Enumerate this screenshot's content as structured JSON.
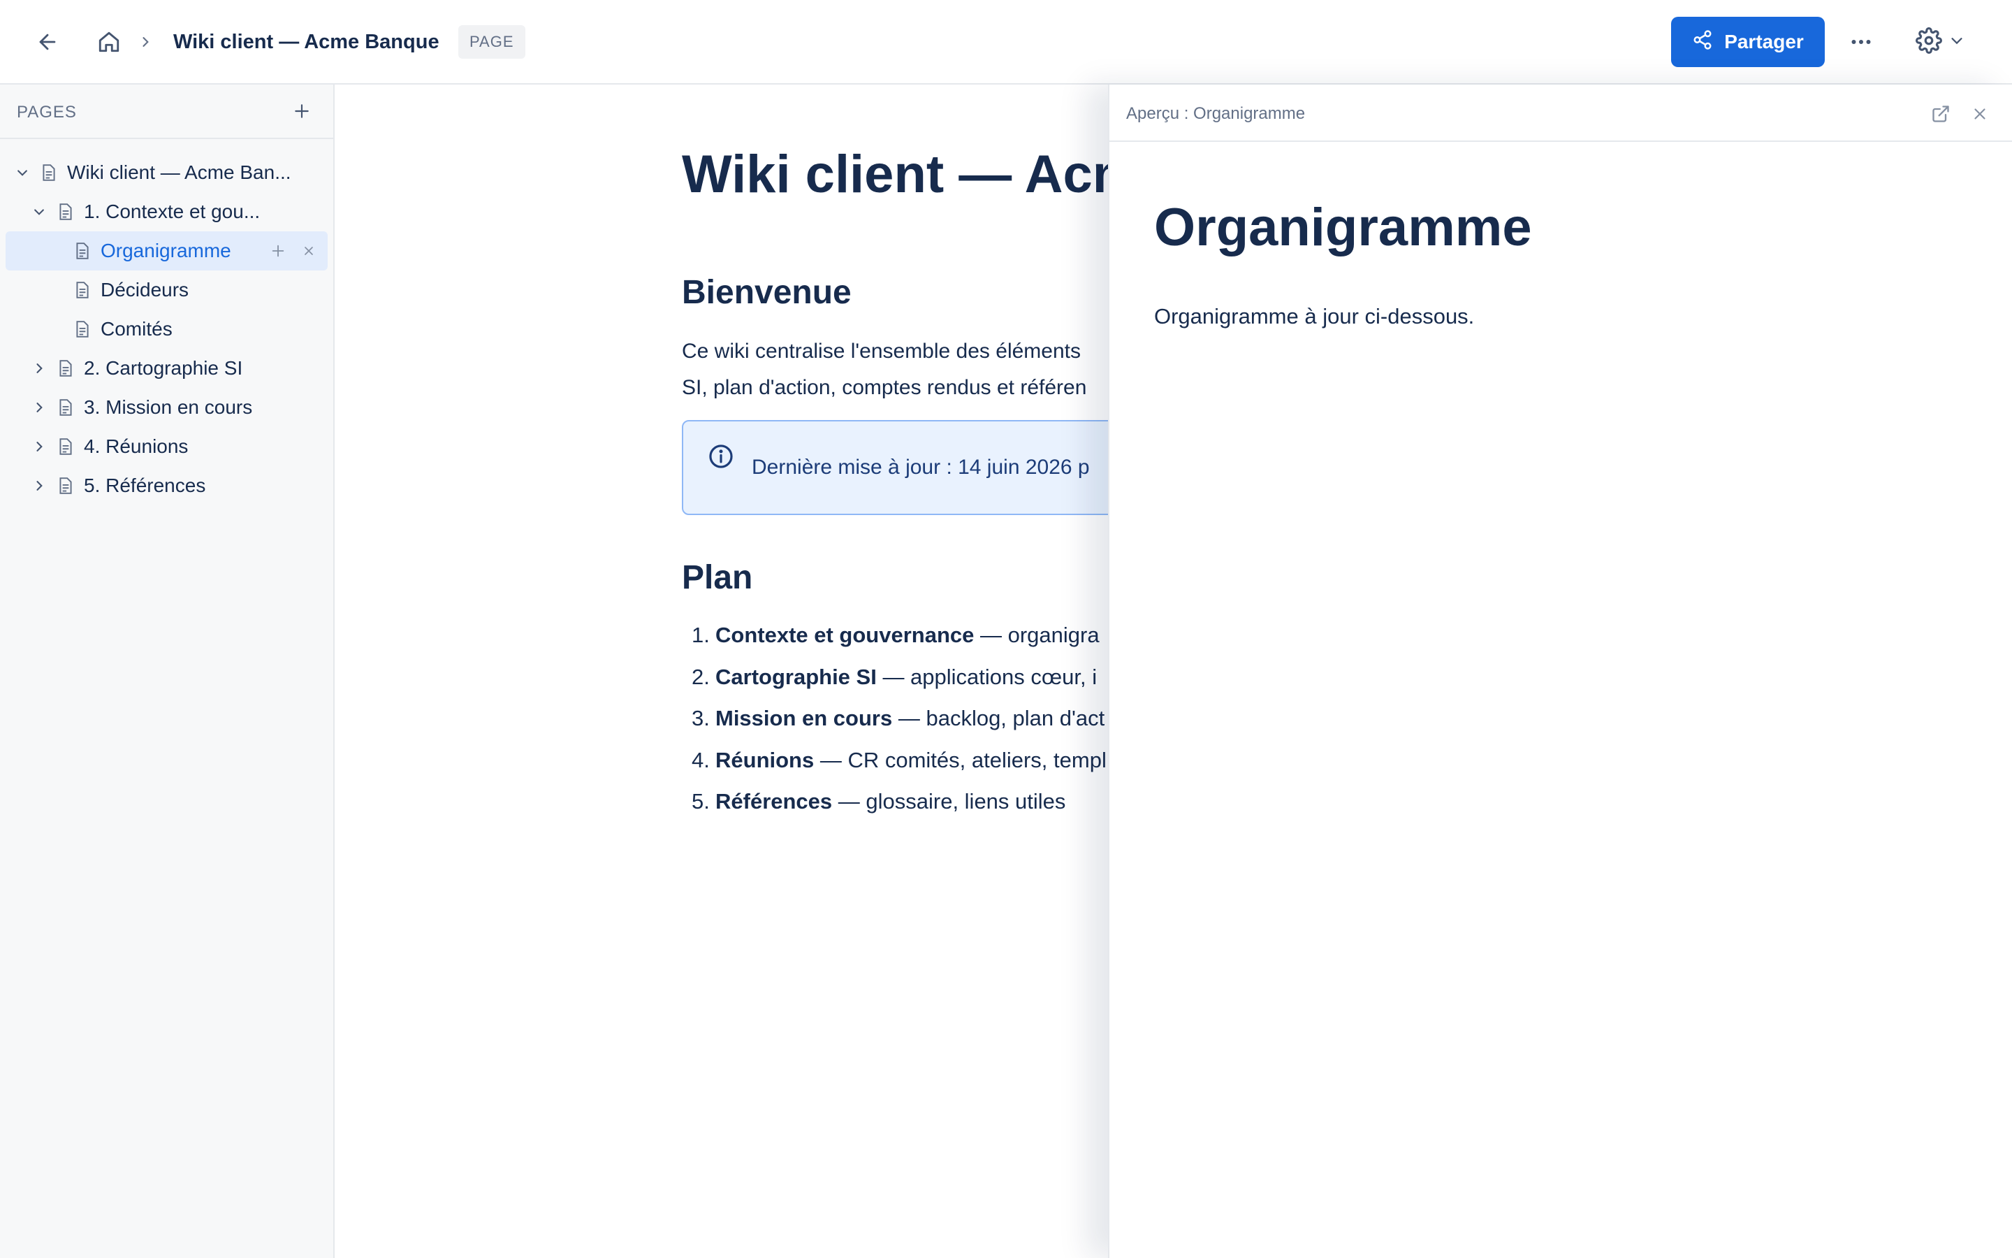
{
  "topbar": {
    "title": "Wiki client — Acme Banque",
    "badge": "PAGE",
    "share_label": "Partager",
    "icons": {
      "back": "arrow-left-icon",
      "home": "home-icon",
      "separator": "chevron-right-icon",
      "share": "share-icon",
      "more": "more-horizontal-icon",
      "settings": "gear-icon",
      "settings_caret": "chevron-down-icon"
    }
  },
  "sidebar": {
    "title": "PAGES",
    "items": [
      {
        "label": "Wiki client — Acme Ban...",
        "level": 0,
        "expanded": true
      },
      {
        "label": "1. Contexte et gou...",
        "level": 1,
        "expanded": true
      },
      {
        "label": "Organigramme",
        "level": 2,
        "selected": true
      },
      {
        "label": "Décideurs",
        "level": 2
      },
      {
        "label": "Comités",
        "level": 2
      },
      {
        "label": "2. Cartographie SI",
        "level": 1,
        "expanded": false
      },
      {
        "label": "3. Mission en cours",
        "level": 1,
        "expanded": false
      },
      {
        "label": "4. Réunions",
        "level": 1,
        "expanded": false
      },
      {
        "label": "5. Références",
        "level": 1,
        "expanded": false
      }
    ]
  },
  "page": {
    "title": "Wiki client — Acme Banque",
    "welcome_heading": "Bienvenue",
    "intro_line1": "Ce wiki centralise l'ensemble des éléments ",
    "intro_line2": "SI, plan d'action, comptes rendus et référen",
    "info_text": "Dernière mise à jour : 14 juin 2026 p",
    "plan_heading": "Plan",
    "plan": [
      {
        "num": "1.",
        "bold": "Contexte et gouvernance",
        "rest": " — organigra"
      },
      {
        "num": "2.",
        "bold": "Cartographie SI",
        "rest": " — applications cœur, i"
      },
      {
        "num": "3.",
        "bold": "Mission en cours",
        "rest": " — backlog, plan d'act"
      },
      {
        "num": "4.",
        "bold": "Réunions",
        "rest": " — CR comités, ateliers, templ"
      },
      {
        "num": "5.",
        "bold": "Références",
        "rest": " — glossaire, liens utiles"
      }
    ]
  },
  "preview": {
    "header_title": "Aperçu : Organigramme",
    "title": "Organigramme",
    "paragraph": "Organigramme à jour ci-dessous."
  },
  "colors": {
    "accent": "#1868db",
    "selected_bg": "#e2ecfc",
    "info_bg": "#e9f2fe",
    "info_border": "#8fb8f6",
    "text": "#172b4d",
    "muted": "#626f86"
  }
}
